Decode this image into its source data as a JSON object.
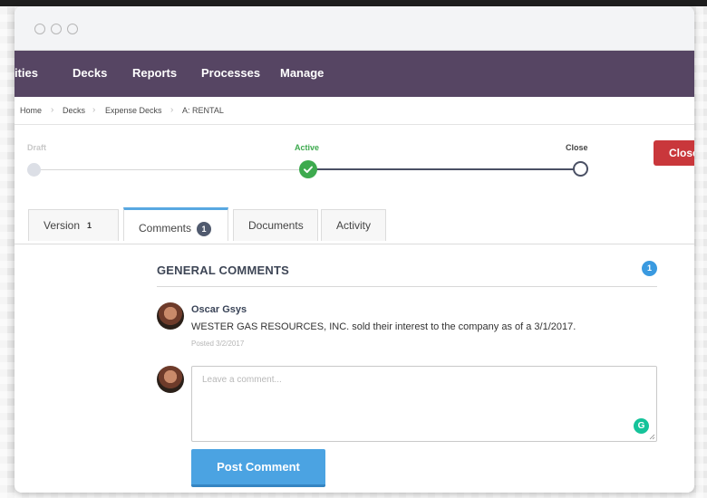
{
  "nav": {
    "items": [
      {
        "label": "Entities"
      },
      {
        "label": "Decks"
      },
      {
        "label": "Reports"
      },
      {
        "label": "Processes"
      },
      {
        "label": "Manage"
      }
    ]
  },
  "breadcrumb": [
    "Home",
    "Decks",
    "Expense Decks",
    "A: RENTAL"
  ],
  "progress": {
    "stages": [
      {
        "label": "Draft",
        "state": "inactive"
      },
      {
        "label": "Active",
        "state": "current"
      },
      {
        "label": "Close",
        "state": "upcoming"
      }
    ],
    "close_button_label": "Close"
  },
  "tabs": [
    {
      "label": "Version",
      "count": "1",
      "active": false
    },
    {
      "label": "Comments",
      "count": "1",
      "active": true
    },
    {
      "label": "Documents",
      "active": false
    },
    {
      "label": "Activity",
      "active": false
    }
  ],
  "comments_section": {
    "title": "GENERAL COMMENTS",
    "count": "1",
    "comments": [
      {
        "author": "Oscar Gsys",
        "text": "WESTER GAS RESOURCES, INC. sold their interest to the company as of a 3/1/2017.",
        "posted": "Posted 3/2/2017"
      }
    ],
    "input_placeholder": "Leave a comment...",
    "post_button_label": "Post Comment"
  },
  "colors": {
    "nav_bg": "#564563",
    "active_green": "#3daa4e",
    "close_red": "#c9373b",
    "accent_blue": "#4ba3e2",
    "grammarly_green": "#15c39a"
  },
  "icons": [
    "check-icon",
    "grammarly-icon",
    "chevron-right-icon",
    "user-avatar"
  ]
}
